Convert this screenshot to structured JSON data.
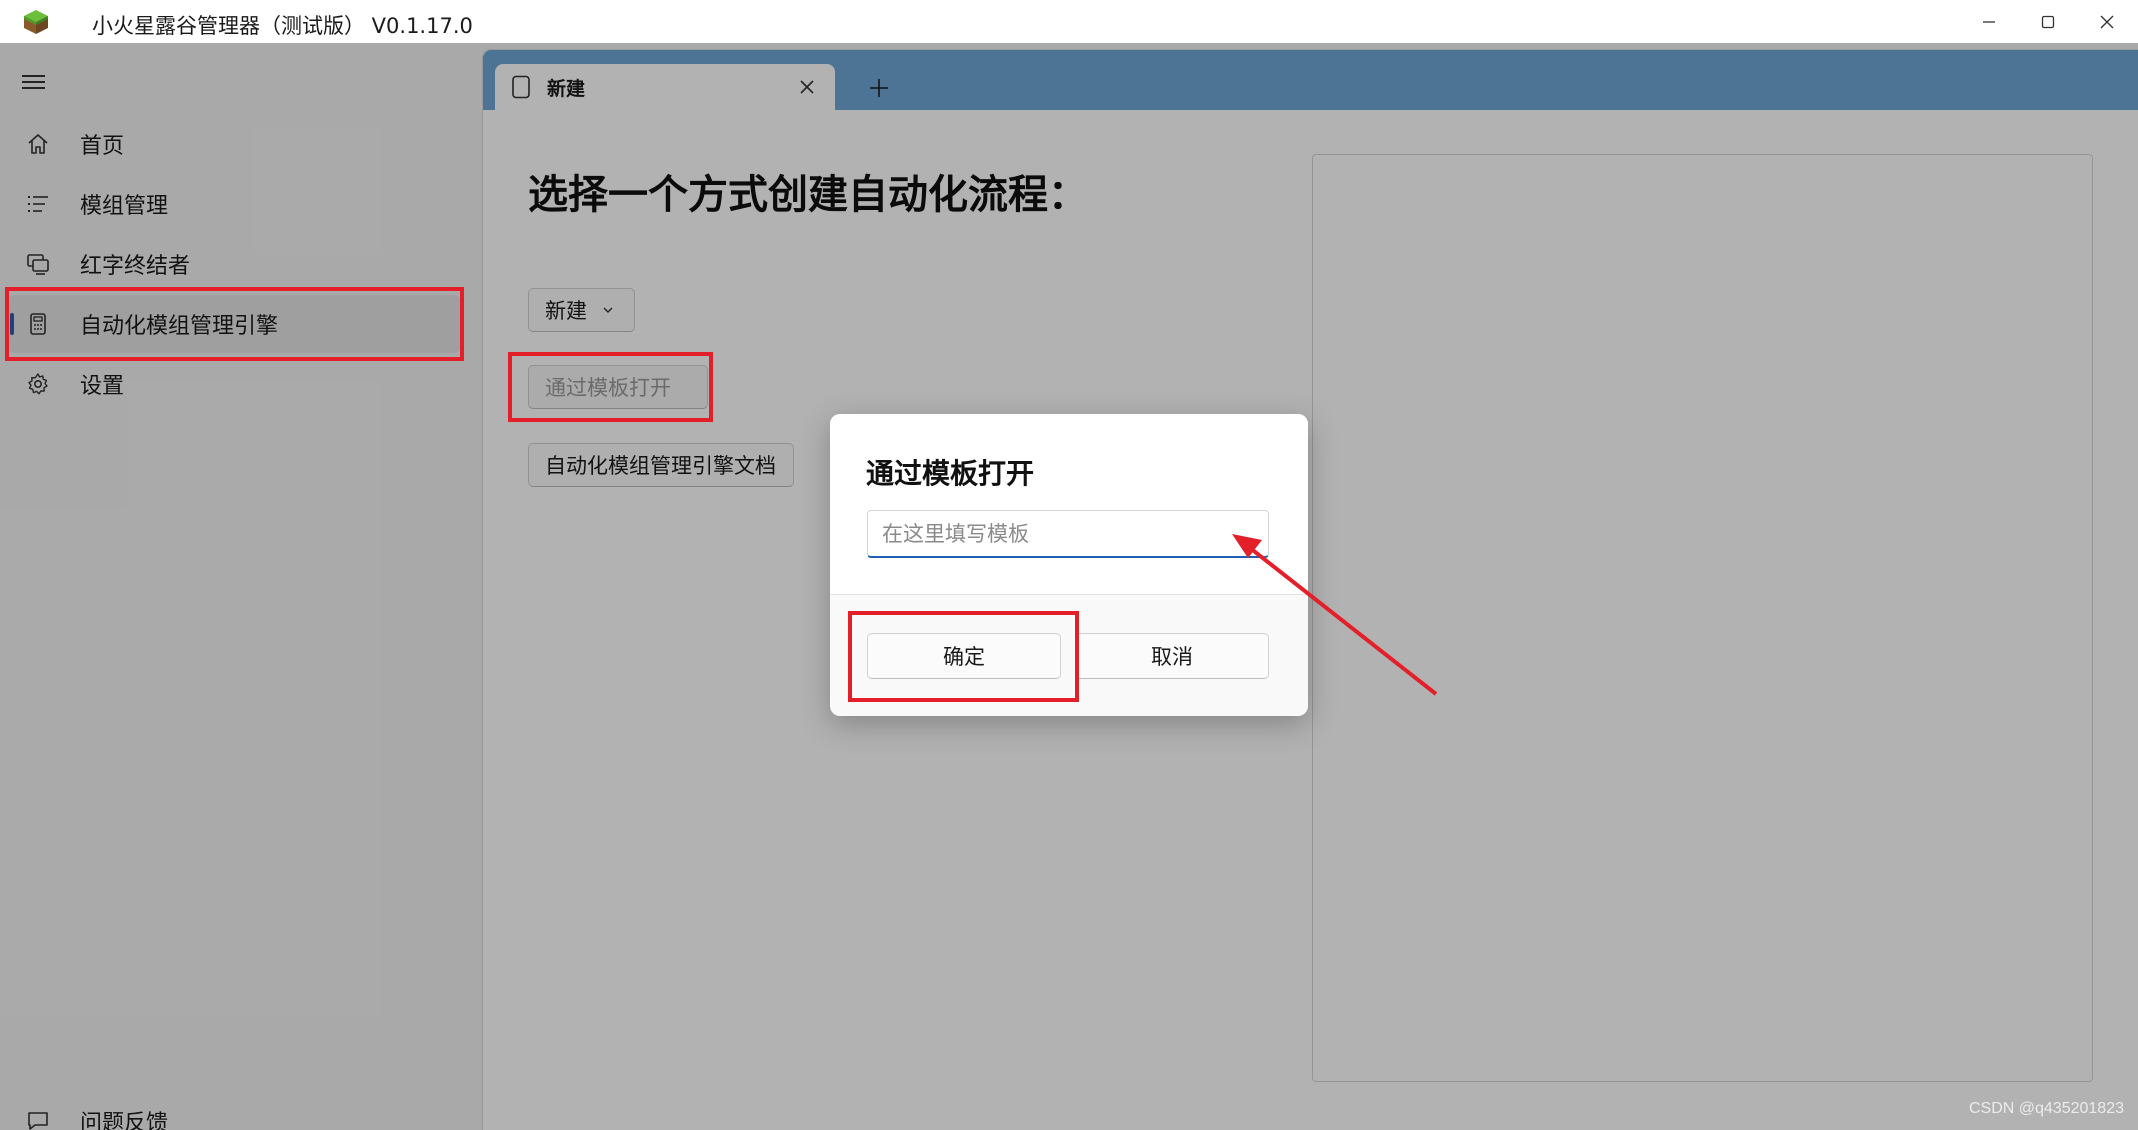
{
  "window": {
    "title": "小火星露谷管理器（测试版） V0.1.17.0"
  },
  "sidebar": {
    "items": [
      {
        "label": "首页",
        "icon": "home-icon"
      },
      {
        "label": "模组管理",
        "icon": "list-icon"
      },
      {
        "label": "红字终结者",
        "icon": "monitor-icon"
      },
      {
        "label": "自动化模组管理引擎",
        "icon": "calculator-icon",
        "selected": true
      },
      {
        "label": "设置",
        "icon": "gear-icon"
      }
    ],
    "footer": {
      "label": "问题反馈",
      "icon": "feedback-icon"
    }
  },
  "tabs": {
    "items": [
      {
        "label": "新建",
        "icon": "document-icon"
      }
    ]
  },
  "main": {
    "heading": "选择一个方式创建自动化流程：",
    "new_button": "新建",
    "template_button": "通过模板打开",
    "docs_button": "自动化模组管理引擎文档"
  },
  "dialog": {
    "title": "通过模板打开",
    "input_placeholder": "在这里填写模板",
    "input_value": "",
    "confirm_label": "确定",
    "cancel_label": "取消"
  },
  "colors": {
    "accent": "#1f5fb5",
    "tabstrip": "#6fa6d6",
    "annotation": "#e3202a"
  },
  "watermark": "CSDN @q435201823"
}
